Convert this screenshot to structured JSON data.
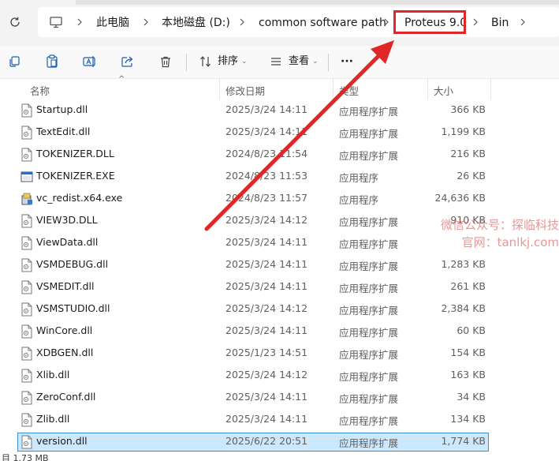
{
  "address": {
    "crumbs": [
      "此电脑",
      "本地磁盘 (D:)",
      "common software path",
      "Proteus 9.0",
      "Bin"
    ]
  },
  "toolbar": {
    "sort_label": "排序",
    "view_label": "查看",
    "more_label": "···"
  },
  "columns": {
    "name": "名称",
    "date": "修改日期",
    "type": "类型",
    "size": "大小"
  },
  "files": [
    {
      "name": "Startup.dll",
      "date": "2025/3/24 14:11",
      "type": "应用程序扩展",
      "size": "366 KB",
      "icon": "dll-file-icon"
    },
    {
      "name": "TextEdit.dll",
      "date": "2025/3/24 14:11",
      "type": "应用程序扩展",
      "size": "1,199 KB",
      "icon": "dll-file-icon"
    },
    {
      "name": "TOKENIZER.DLL",
      "date": "2024/8/23 11:54",
      "type": "应用程序扩展",
      "size": "216 KB",
      "icon": "dll-file-icon"
    },
    {
      "name": "TOKENIZER.EXE",
      "date": "2024/8/23 11:53",
      "type": "应用程序",
      "size": "26 KB",
      "icon": "exe-file-icon"
    },
    {
      "name": "vc_redist.x64.exe",
      "date": "2024/8/23 11:57",
      "type": "应用程序",
      "size": "24,636 KB",
      "icon": "installer-icon"
    },
    {
      "name": "VIEW3D.DLL",
      "date": "2025/3/24 14:12",
      "type": "应用程序扩展",
      "size": "910 KB",
      "icon": "dll-file-icon"
    },
    {
      "name": "ViewData.dll",
      "date": "2025/3/24 14:11",
      "type": "应用程序扩展",
      "size": "",
      "icon": "dll-file-icon"
    },
    {
      "name": "VSMDEBUG.dll",
      "date": "2025/3/24 14:11",
      "type": "应用程序扩展",
      "size": "1,283 KB",
      "icon": "dll-file-icon"
    },
    {
      "name": "VSMEDIT.dll",
      "date": "2025/3/24 14:11",
      "type": "应用程序扩展",
      "size": "261 KB",
      "icon": "dll-file-icon"
    },
    {
      "name": "VSMSTUDIO.dll",
      "date": "2025/3/24 14:12",
      "type": "应用程序扩展",
      "size": "2,384 KB",
      "icon": "dll-file-icon"
    },
    {
      "name": "WinCore.dll",
      "date": "2025/3/24 14:11",
      "type": "应用程序扩展",
      "size": "60 KB",
      "icon": "dll-file-icon"
    },
    {
      "name": "XDBGEN.dll",
      "date": "2025/1/23 14:51",
      "type": "应用程序扩展",
      "size": "154 KB",
      "icon": "dll-file-icon"
    },
    {
      "name": "Xlib.dll",
      "date": "2025/3/24 14:12",
      "type": "应用程序扩展",
      "size": "163 KB",
      "icon": "dll-file-icon"
    },
    {
      "name": "ZeroConf.dll",
      "date": "2025/3/24 14:11",
      "type": "应用程序扩展",
      "size": "34 KB",
      "icon": "dll-file-icon"
    },
    {
      "name": "Zlib.dll",
      "date": "2025/3/24 14:11",
      "type": "应用程序扩展",
      "size": "134 KB",
      "icon": "dll-file-icon"
    },
    {
      "name": "version.dll",
      "date": "2025/6/22 20:51",
      "type": "应用程序扩展",
      "size": "1,774 KB",
      "icon": "dll-file-icon",
      "selected": true
    }
  ],
  "watermark": {
    "line1": "微信公众号：探临科技",
    "line2": "官网：tanlkj.com"
  },
  "status": {
    "text": "目  1.73 MB"
  },
  "colors": {
    "highlight": "#e02626",
    "arrow": "#e02626",
    "selection_bg": "#cce8ff",
    "selection_border": "#3a8fd8"
  }
}
